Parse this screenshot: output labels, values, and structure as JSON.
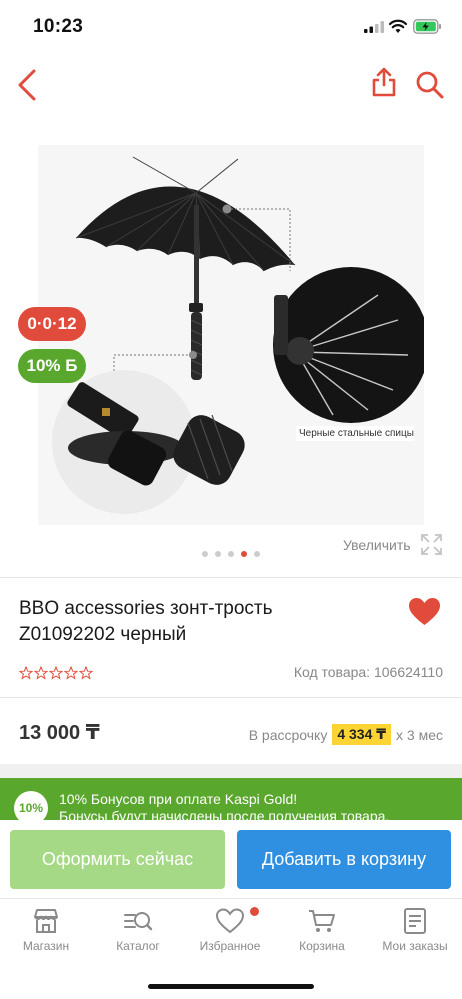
{
  "status_bar": {
    "time": "10:23"
  },
  "nav": {
    "back_icon": "chevron-left-icon",
    "share_icon": "share-icon",
    "search_icon": "search-icon"
  },
  "gallery": {
    "countdown_badge": "0·0·12",
    "bonus_badge": "10% Б",
    "callout": "Черные стальные спицы",
    "dots_total": 5,
    "active_dot": 3,
    "zoom_label": "Увеличить"
  },
  "product": {
    "title": "BBO accessories зонт-трость Z01092202 черный",
    "rating_stars": 0,
    "sku_label": "Код товара: 106624110"
  },
  "price": {
    "amount": "13 000 ₸",
    "installment_prefix": "В рассрочку",
    "installment_amount": "4 334 ₸",
    "installment_suffix": "х 3 мес"
  },
  "bonus_banner": {
    "circle": "10%",
    "line1": "10% Бонусов при оплате Kaspi Gold!",
    "line2": "Бонусы будут начислены после получения товара."
  },
  "actions": {
    "buy_now": "Оформить сейчас",
    "add_to_cart": "Добавить в корзину"
  },
  "tabs": [
    {
      "label": "Магазин",
      "icon": "store-icon"
    },
    {
      "label": "Каталог",
      "icon": "catalog-icon"
    },
    {
      "label": "Избранное",
      "icon": "heart-icon"
    },
    {
      "label": "Корзина",
      "icon": "cart-icon"
    },
    {
      "label": "Мои заказы",
      "icon": "orders-icon"
    }
  ],
  "colors": {
    "accent_red": "#e04b3b",
    "green": "#5aa72d",
    "blue": "#2f8fe0",
    "yellow": "#fcd535"
  }
}
